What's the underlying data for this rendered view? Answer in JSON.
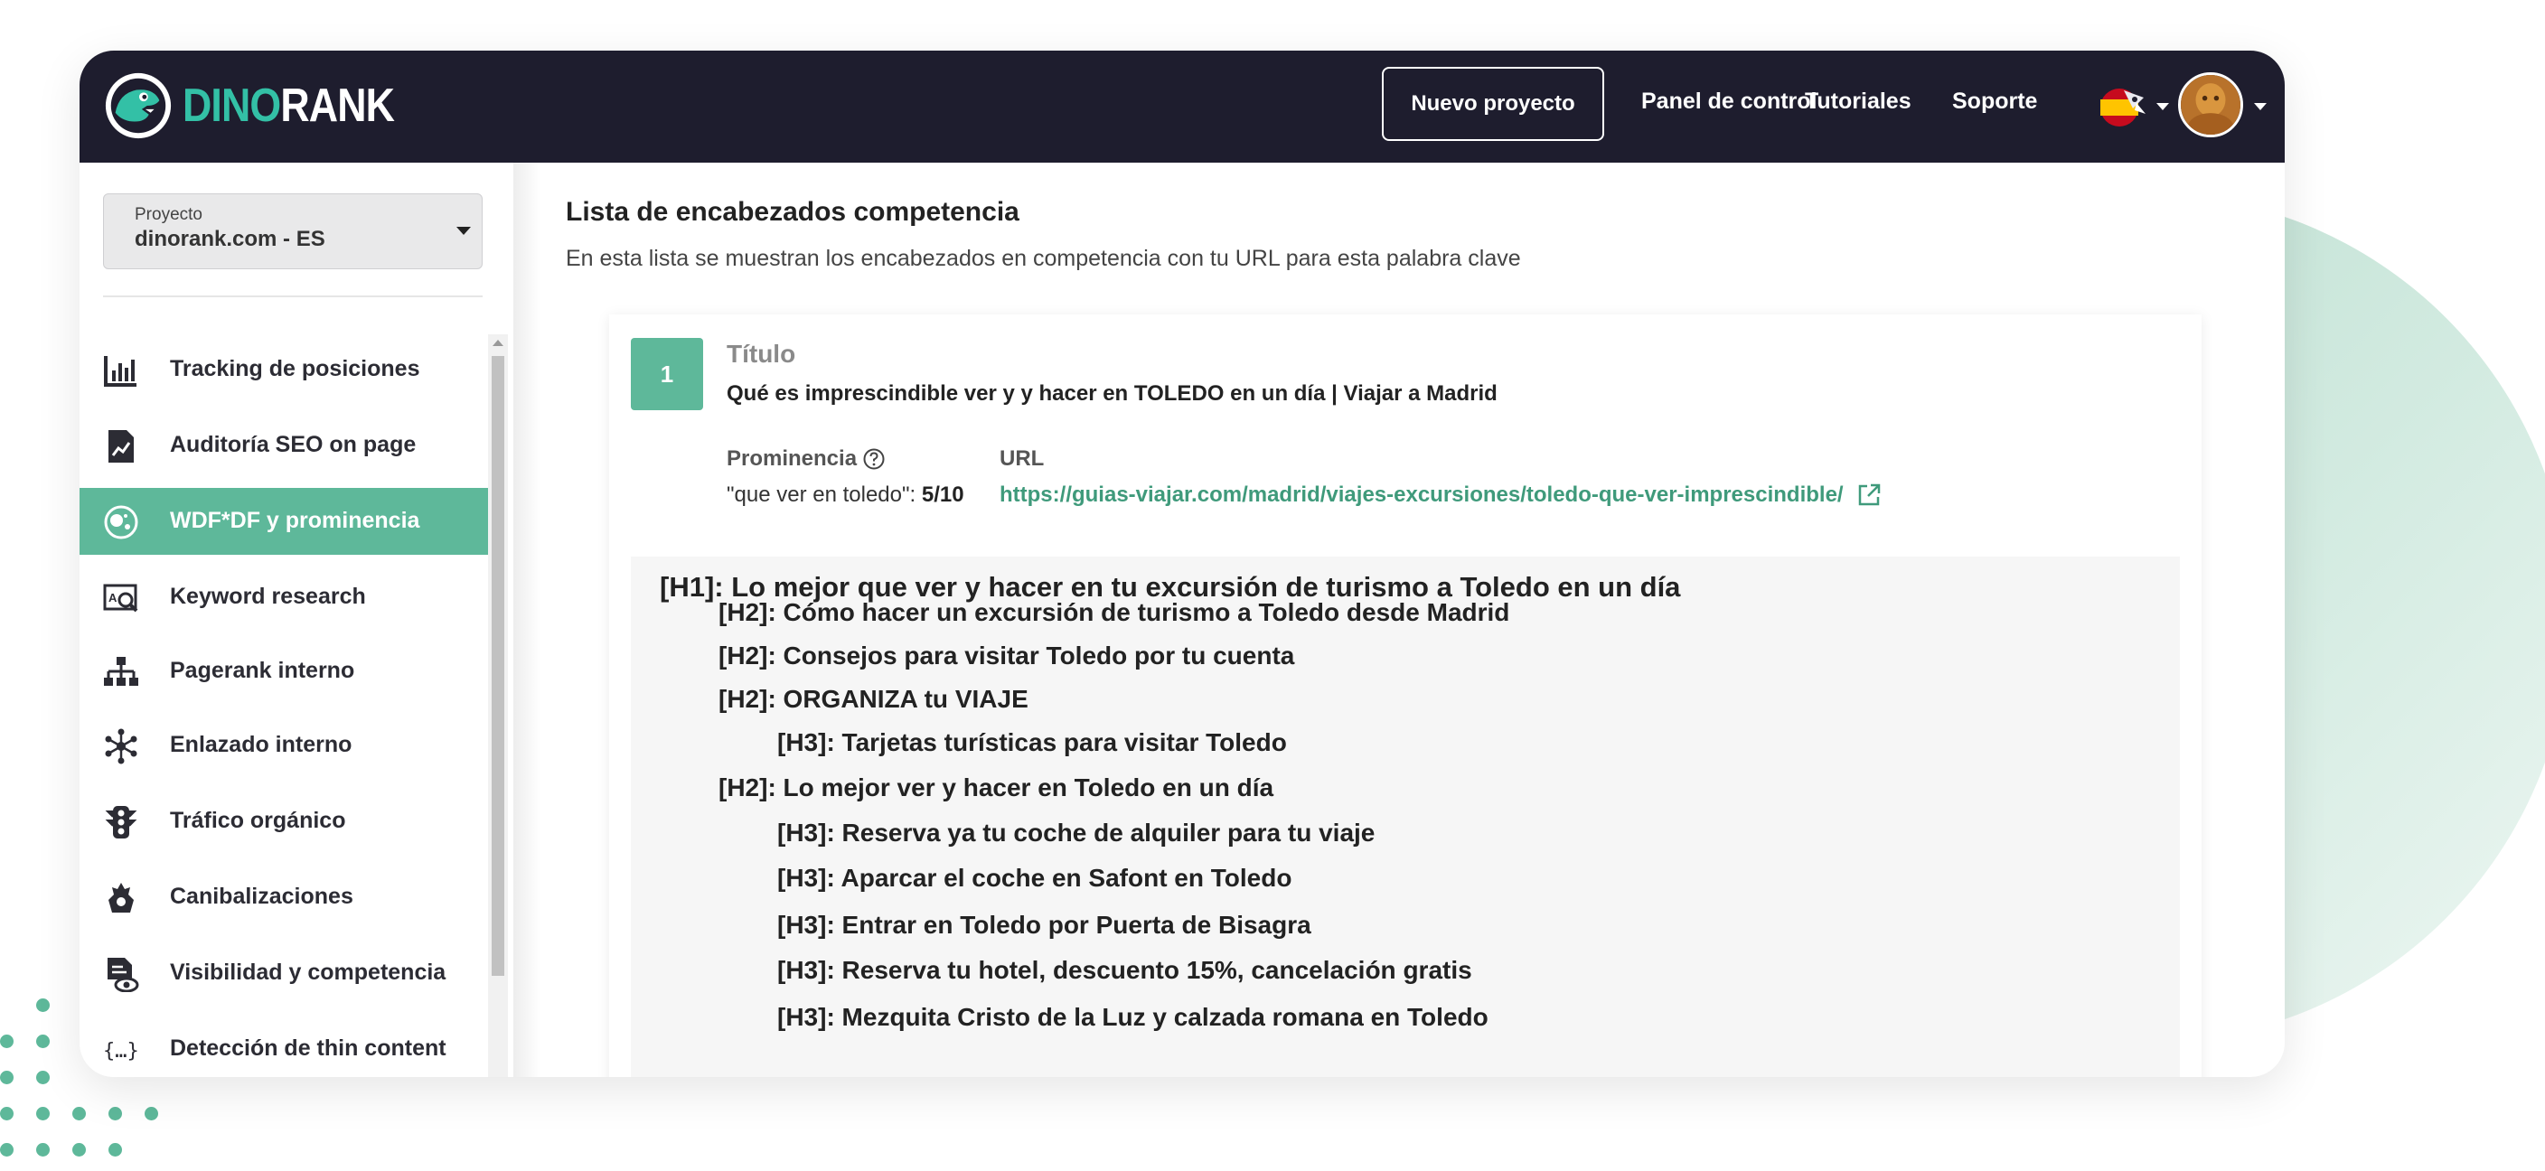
{
  "header": {
    "brand_part1": "DINO",
    "brand_part2": "RANK",
    "new_project_label": "Nuevo proyecto",
    "nav": [
      "Panel de control",
      "Tutoriales",
      "Soporte"
    ],
    "language_icon": "spain-flag-rocket-icon",
    "avatar_icon": "user-avatar"
  },
  "sidebar": {
    "project_label": "Proyecto",
    "project_value": "dinorank.com - ES",
    "items": [
      {
        "label": "Tracking de posiciones",
        "icon": "bar-chart-icon",
        "active": false
      },
      {
        "label": "Auditoría SEO on page",
        "icon": "document-chart-icon",
        "active": false
      },
      {
        "label": "WDF*DF y prominencia",
        "icon": "bubbles-icon",
        "active": true
      },
      {
        "label": "Keyword research",
        "icon": "keyword-search-icon",
        "active": false
      },
      {
        "label": "Pagerank interno",
        "icon": "sitemap-icon",
        "active": false
      },
      {
        "label": "Enlazado interno",
        "icon": "network-icon",
        "active": false
      },
      {
        "label": "Tráfico orgánico",
        "icon": "traffic-light-icon",
        "active": false
      },
      {
        "label": "Canibalizaciones",
        "icon": "dino-icon",
        "active": false
      },
      {
        "label": "Visibilidad y competencia",
        "icon": "document-eye-icon",
        "active": false
      },
      {
        "label": "Detección de thin content",
        "icon": "braces-icon",
        "active": false
      }
    ]
  },
  "main": {
    "title": "Lista de encabezados competencia",
    "subtitle": "En esta lista se muestran los encabezados en competencia con tu URL para esta palabra clave",
    "result": {
      "rank": "1",
      "title_label": "Título",
      "title_value": "Qué es imprescindible ver y y hacer en TOLEDO en un día | Viajar a Madrid",
      "prominence_label": "Prominencia",
      "prominence_keyword": "\"que ver en toledo\": ",
      "prominence_score": "5/10",
      "url_label": "URL",
      "url": "https://guias-viajar.com/madrid/viajes-excursiones/toledo-que-ver-imprescindible/",
      "headings": [
        {
          "level": "h1",
          "text": "[H1]: Lo mejor que ver y hacer en tu excursión de turismo a Toledo en un día"
        },
        {
          "level": "h2",
          "text": "[H2]: Cómo hacer un excursión de turismo a Toledo desde Madrid"
        },
        {
          "level": "h2",
          "text": "[H2]: Consejos para visitar Toledo por tu cuenta"
        },
        {
          "level": "h2",
          "text": "[H2]: ORGANIZA tu VIAJE"
        },
        {
          "level": "h3",
          "text": "[H3]: Tarjetas turísticas para visitar Toledo"
        },
        {
          "level": "h2",
          "text": "[H2]: Lo mejor ver y hacer en Toledo en un día"
        },
        {
          "level": "h3",
          "text": "[H3]: Reserva ya tu coche de alquiler para tu viaje"
        },
        {
          "level": "h3",
          "text": "[H3]: Aparcar el coche en Safont en Toledo"
        },
        {
          "level": "h3",
          "text": "[H3]: Entrar en Toledo por Puerta de Bisagra"
        },
        {
          "level": "h3",
          "text": "[H3]: Reserva tu hotel, descuento 15%, cancelación gratis"
        },
        {
          "level": "h3",
          "text": "[H3]: Mezquita Cristo de la Luz y calzada romana en Toledo"
        }
      ]
    }
  },
  "colors": {
    "topbar": "#1e1d2e",
    "accent": "#5eb89a",
    "brand_teal": "#33c0a6",
    "link": "#3f9a7b"
  }
}
